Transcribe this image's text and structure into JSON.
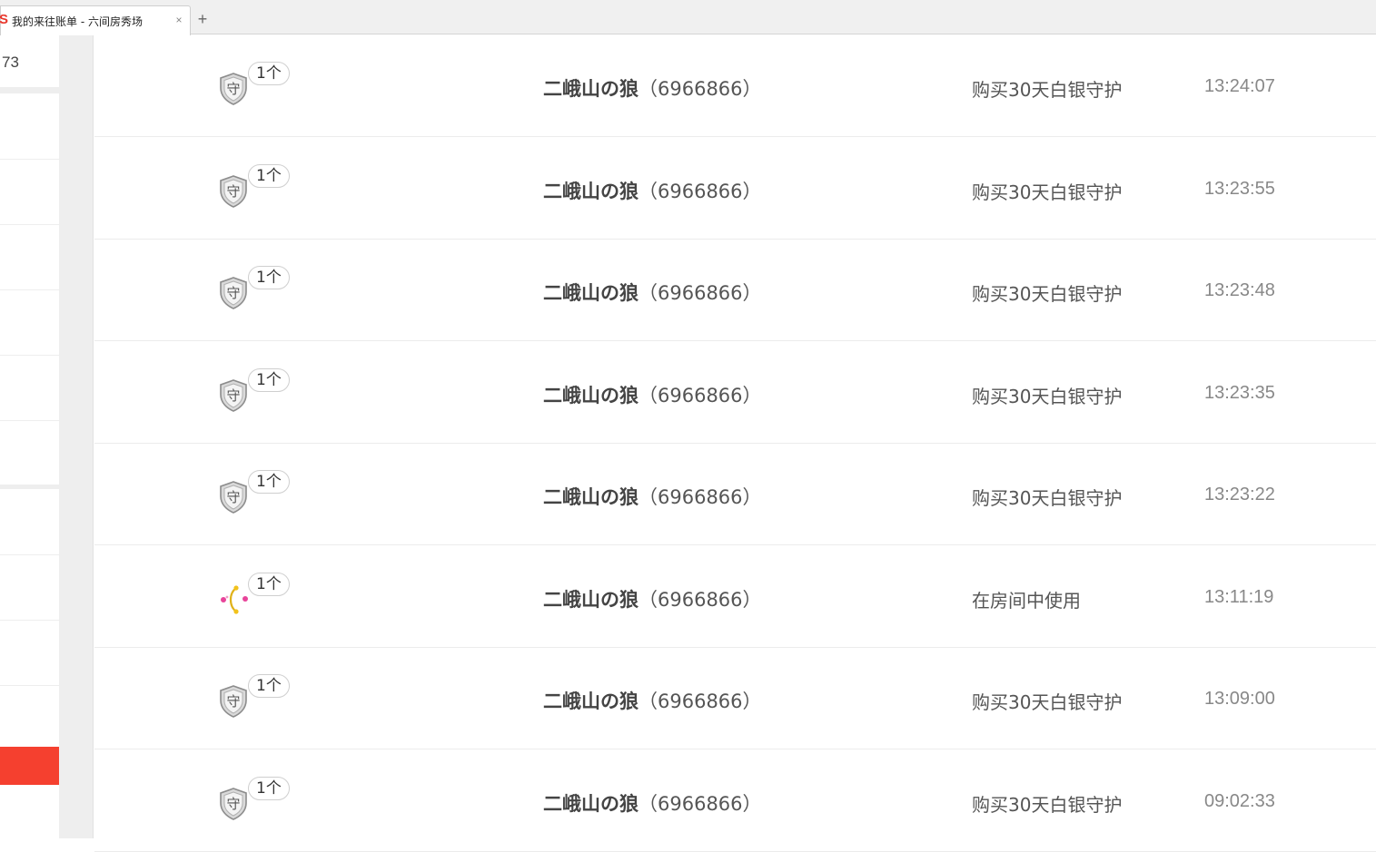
{
  "browser": {
    "tab_title": "我的来往账单 - 六间房秀场",
    "tab_close": "×",
    "new_tab": "+"
  },
  "sidebar": {
    "count_text": "73"
  },
  "rows": [
    {
      "gift_icon": "shield-guard-icon",
      "quantity": "1个",
      "user_name": "二峨山の狼",
      "user_id": "（6966866）",
      "action": "购买30天白银守护",
      "time": "13:24:07"
    },
    {
      "gift_icon": "shield-guard-icon",
      "quantity": "1个",
      "user_name": "二峨山の狼",
      "user_id": "（6966866）",
      "action": "购买30天白银守护",
      "time": "13:23:55"
    },
    {
      "gift_icon": "shield-guard-icon",
      "quantity": "1个",
      "user_name": "二峨山の狼",
      "user_id": "（6966866）",
      "action": "购买30天白银守护",
      "time": "13:23:48"
    },
    {
      "gift_icon": "shield-guard-icon",
      "quantity": "1个",
      "user_name": "二峨山の狼",
      "user_id": "（6966866）",
      "action": "购买30天白银守护",
      "time": "13:23:35"
    },
    {
      "gift_icon": "shield-guard-icon",
      "quantity": "1个",
      "user_name": "二峨山の狼",
      "user_id": "（6966866）",
      "action": "购买30天白银守护",
      "time": "13:23:22"
    },
    {
      "gift_icon": "flower-bow-icon",
      "quantity": "1个",
      "user_name": "二峨山の狼",
      "user_id": "（6966866）",
      "action": "在房间中使用",
      "time": "13:11:19"
    },
    {
      "gift_icon": "shield-guard-icon",
      "quantity": "1个",
      "user_name": "二峨山の狼",
      "user_id": "（6966866）",
      "action": "购买30天白银守护",
      "time": "13:09:00"
    },
    {
      "gift_icon": "shield-guard-icon",
      "quantity": "1个",
      "user_name": "二峨山の狼",
      "user_id": "（6966866）",
      "action": "购买30天白银守护",
      "time": "09:02:33"
    }
  ],
  "colors": {
    "accent": "#f5402f",
    "favicon": "#e8362b",
    "gutter": "#eeeeee"
  }
}
